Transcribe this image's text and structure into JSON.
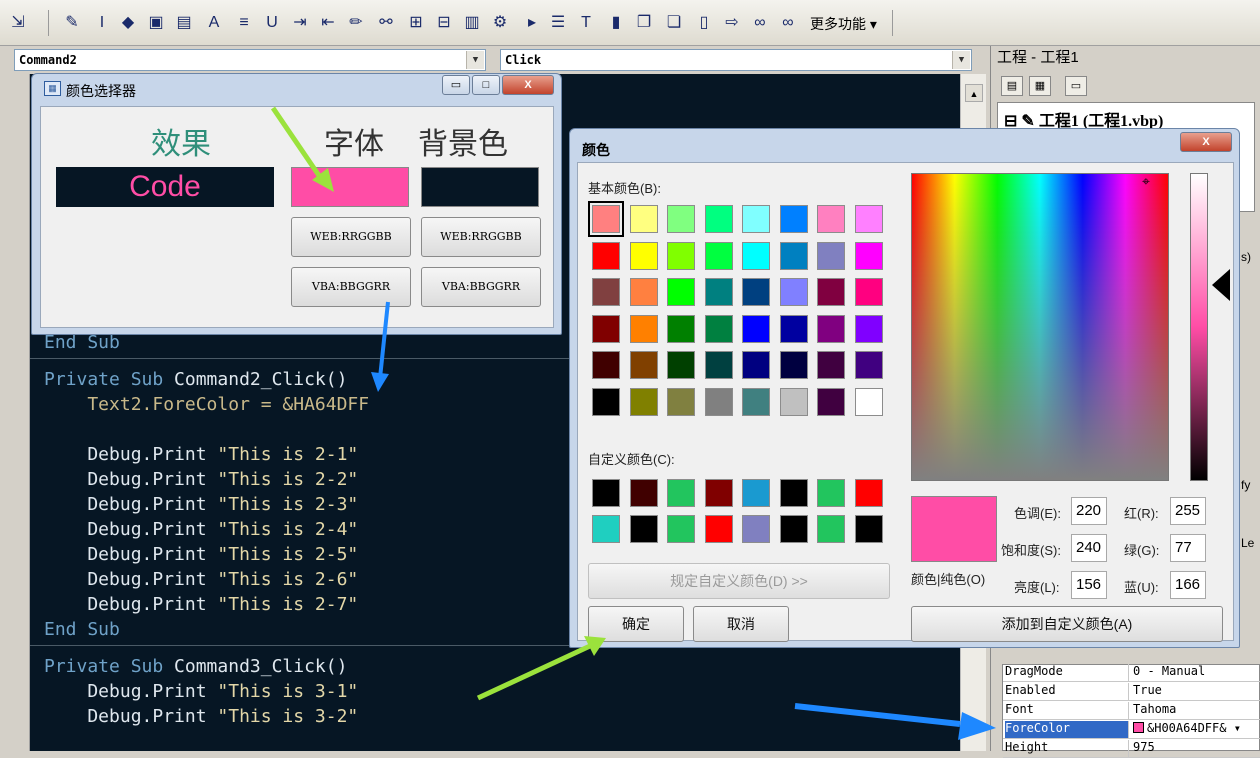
{
  "toolbar": {
    "more_label": "更多功能",
    "icons": [
      "expand-icon",
      "pen-icon",
      "italic-icon",
      "vs-icon",
      "save-icon",
      "save-all-icon",
      "ai-icon",
      "align-icon",
      "underline-icon",
      "indent-icon",
      "outdent-icon",
      "pencil-icon",
      "link-icon",
      "grid-icon",
      "table-icon",
      "layout-icon",
      "gear-icon",
      "run-icon",
      "list-icon",
      "text-size-icon",
      "bookmark-icon",
      "book-icon",
      "book2-icon",
      "page-icon",
      "export-icon",
      "binocular-icon",
      "binocular2-icon"
    ]
  },
  "code_window": {
    "object_combo": "Command2",
    "proc_combo": "Click",
    "lines": [
      {
        "kind": "plain",
        "text": "End Sub",
        "top": 0
      },
      {
        "kind": "sep"
      },
      {
        "kind": "sub",
        "kw1": "Private Sub",
        "name": "Command2_Click()"
      },
      {
        "kind": "assign",
        "text": "    Text2.ForeColor = &HA64DFF"
      },
      {
        "kind": "blank"
      },
      {
        "kind": "print",
        "prefix": "    Debug.Print ",
        "str": "\"This is 2-1\""
      },
      {
        "kind": "print",
        "prefix": "    Debug.Print ",
        "str": "\"This is 2-2\""
      },
      {
        "kind": "print",
        "prefix": "    Debug.Print ",
        "str": "\"This is 2-3\""
      },
      {
        "kind": "print",
        "prefix": "    Debug.Print ",
        "str": "\"This is 2-4\""
      },
      {
        "kind": "print",
        "prefix": "    Debug.Print ",
        "str": "\"This is 2-5\""
      },
      {
        "kind": "print",
        "prefix": "    Debug.Print ",
        "str": "\"This is 2-6\""
      },
      {
        "kind": "print",
        "prefix": "    Debug.Print ",
        "str": "\"This is 2-7\""
      },
      {
        "kind": "end",
        "text": "End Sub"
      },
      {
        "kind": "sep"
      },
      {
        "kind": "sub",
        "kw1": "Private Sub",
        "name": "Command3_Click()"
      },
      {
        "kind": "print",
        "prefix": "    Debug.Print ",
        "str": "\"This is 3-1\""
      },
      {
        "kind": "print",
        "prefix": "    Debug.Print ",
        "str": "\"This is 3-2\""
      }
    ]
  },
  "project": {
    "title": "工程 - 工程1",
    "node": "工程1 (工程1.vbp)",
    "side_fragments": [
      "s)",
      "fy",
      "Le"
    ]
  },
  "properties": [
    {
      "key": "DragMode",
      "value": "0 - Manual"
    },
    {
      "key": "Enabled",
      "value": "True"
    },
    {
      "key": "Font",
      "value": "Tahoma"
    },
    {
      "key": "ForeColor",
      "value": "&H00A64DFF&",
      "selected": true
    },
    {
      "key": "Height",
      "value": "975"
    }
  ],
  "picker": {
    "title": "颜色选择器",
    "label_effect": "效果",
    "label_font": "字体",
    "label_bg": "背景色",
    "code_text": "Code",
    "web_btn_1": "WEB:RRGGBB",
    "web_btn_2": "WEB:RRGGBB",
    "vba_btn_1": "VBA:BBGGRR",
    "vba_btn_2": "VBA:BBGGRR",
    "win_min": "▭",
    "win_max": "□",
    "win_close": "X"
  },
  "color_dialog": {
    "title": "颜色",
    "basic_label": "基本颜色(B):",
    "custom_label": "自定义颜色(C):",
    "define_btn": "规定自定义颜色(D) >>",
    "ok_btn": "确定",
    "cancel_btn": "取消",
    "add_btn": "添加到自定义颜色(A)",
    "preview_label": "颜色|纯色(O)",
    "hue_label": "色调(E):",
    "sat_label": "饱和度(S):",
    "lum_label": "亮度(L):",
    "red_label": "红(R):",
    "green_label": "绿(G):",
    "blue_label": "蓝(U):",
    "hue": "220",
    "sat": "240",
    "lum": "156",
    "red": "255",
    "green": "77",
    "blue": "166",
    "close": "X",
    "basic_colors": [
      "#ff8080",
      "#ffff80",
      "#80ff80",
      "#00ff80",
      "#80ffff",
      "#0080ff",
      "#ff80c0",
      "#ff80ff",
      "#ff0000",
      "#ffff00",
      "#80ff00",
      "#00ff40",
      "#00ffff",
      "#0080c0",
      "#8080c0",
      "#ff00ff",
      "#804040",
      "#ff8040",
      "#00ff00",
      "#008080",
      "#004080",
      "#8080ff",
      "#800040",
      "#ff0080",
      "#800000",
      "#ff8000",
      "#008000",
      "#008040",
      "#0000ff",
      "#0000a0",
      "#800080",
      "#8000ff",
      "#400000",
      "#804000",
      "#004000",
      "#004040",
      "#000080",
      "#000040",
      "#400040",
      "#400080",
      "#000000",
      "#808000",
      "#808040",
      "#808080",
      "#408080",
      "#c0c0c0",
      "#400040",
      "#ffffff"
    ],
    "custom_colors": [
      "#000000",
      "#400000",
      "#22c55e",
      "#800000",
      "#1a9ad0",
      "#000000",
      "#22c55e",
      "#ff0000",
      "#1fcfc0",
      "#000000",
      "#22c55e",
      "#ff0000",
      "#8080c0",
      "#000000",
      "#22c55e",
      "#000000"
    ]
  },
  "colors": {
    "accent_pink": "#ff4da6",
    "code_bg": "#061624",
    "arrow_green": "#9be23c",
    "arrow_blue": "#1e88ff"
  }
}
